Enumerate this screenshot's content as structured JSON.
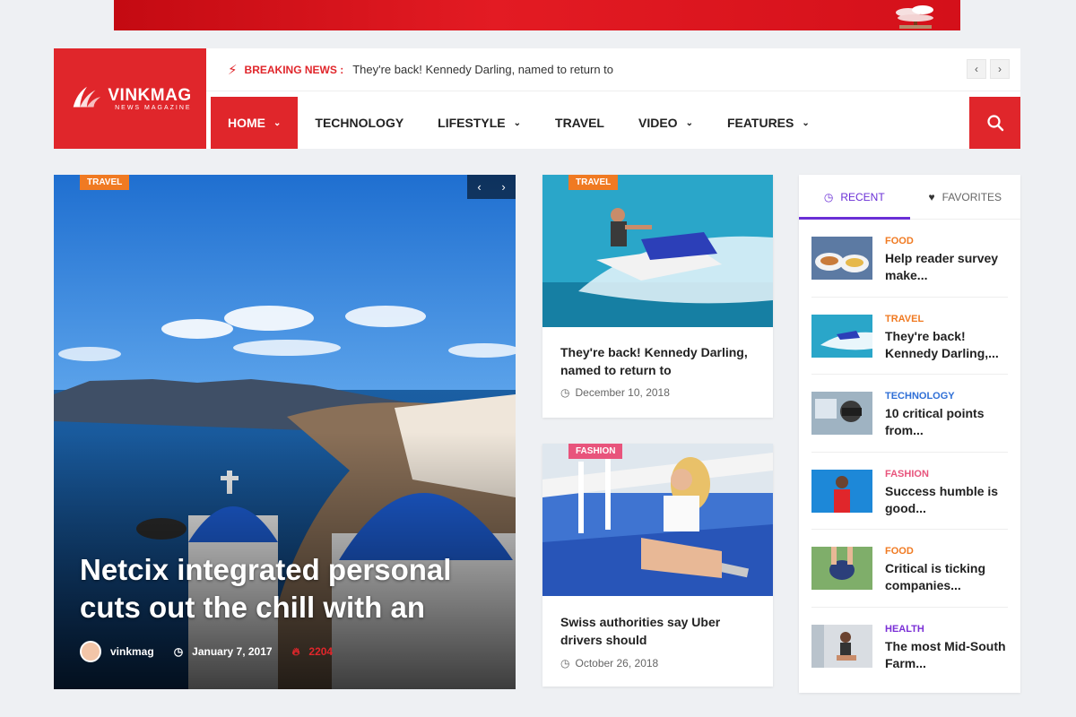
{
  "breaking": {
    "label": "BREAKING NEWS :",
    "text": "They're back! Kennedy Darling, named to return to"
  },
  "logo": {
    "name": "VINKMAG",
    "tagline": "NEWS MAGAZINE"
  },
  "nav": {
    "items": [
      {
        "label": "HOME",
        "active": true,
        "dropdown": true
      },
      {
        "label": "TECHNOLOGY",
        "active": false,
        "dropdown": false
      },
      {
        "label": "LIFESTYLE",
        "active": false,
        "dropdown": true
      },
      {
        "label": "TRAVEL",
        "active": false,
        "dropdown": false
      },
      {
        "label": "VIDEO",
        "active": false,
        "dropdown": true
      },
      {
        "label": "FEATURES",
        "active": false,
        "dropdown": true
      }
    ]
  },
  "hero": {
    "category": "TRAVEL",
    "title": "Netcix integrated personal cuts out the chill with an",
    "author": "vinkmag",
    "date": "January 7, 2017",
    "views": "2204"
  },
  "cards": [
    {
      "category": "TRAVEL",
      "title": "They're back! Kennedy Darling, named to return to",
      "date": "December 10, 2018"
    },
    {
      "category": "FASHION",
      "title": "Swiss authorities say Uber drivers should",
      "date": "October 26, 2018"
    }
  ],
  "sidebar": {
    "tabs": {
      "recent": "RECENT",
      "favorites": "FAVORITES"
    },
    "items": [
      {
        "category": "FOOD",
        "title": "Help reader survey make..."
      },
      {
        "category": "TRAVEL",
        "title": "They're back! Kennedy Darling,..."
      },
      {
        "category": "TECHNOLOGY",
        "title": "10 critical points from..."
      },
      {
        "category": "FASHION",
        "title": "Success humble is good..."
      },
      {
        "category": "FOOD",
        "title": "Critical is ticking companies..."
      },
      {
        "category": "HEALTH",
        "title": "The most Mid-South Farm..."
      }
    ]
  },
  "colors": {
    "brand": "#e0262b",
    "travel": "#f07a22",
    "fashion": "#e8547c",
    "food": "#f07a22",
    "technology": "#2f6fd6",
    "health": "#7a2fd6",
    "tab_accent": "#6a2fd6"
  },
  "icons": {
    "bolt": "bolt-icon",
    "search": "search-icon",
    "clock": "clock-icon",
    "heart": "heart-icon",
    "fire": "fire-icon"
  }
}
